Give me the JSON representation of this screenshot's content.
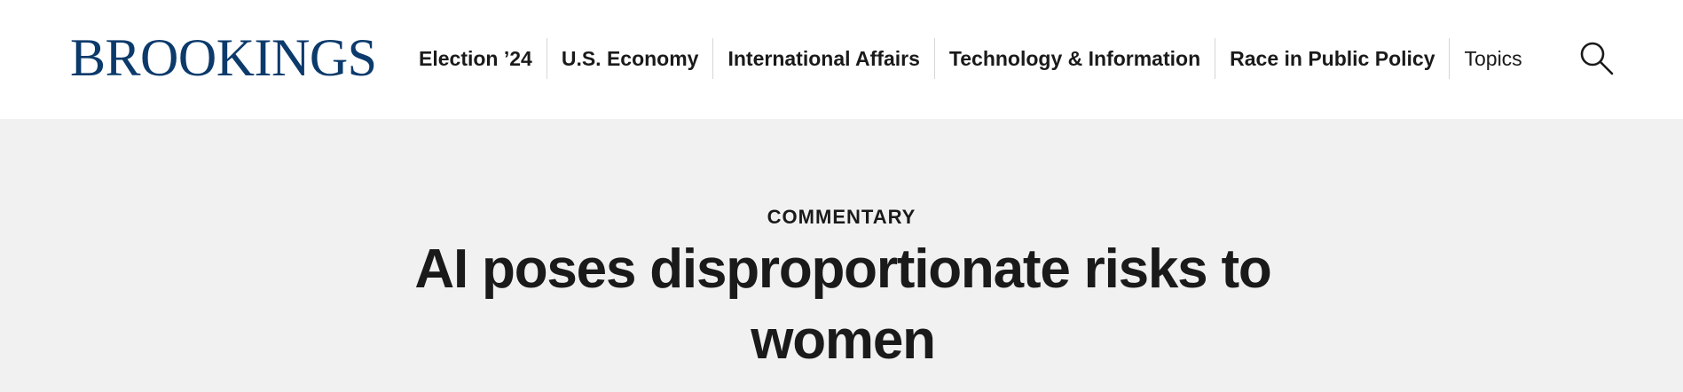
{
  "header": {
    "logo_text": "BROOKINGS",
    "brand_color": "#0b3a6b",
    "nav_items": [
      {
        "label": "Election ’24"
      },
      {
        "label": "U.S. Economy"
      },
      {
        "label": "International Affairs"
      },
      {
        "label": "Technology & Information"
      },
      {
        "label": "Race in Public Policy"
      },
      {
        "label": "Topics"
      }
    ],
    "search_icon": "search-icon"
  },
  "hero": {
    "background": "#f1f1f1",
    "category": "COMMENTARY",
    "headline": "AI poses disproportionate risks to women"
  }
}
